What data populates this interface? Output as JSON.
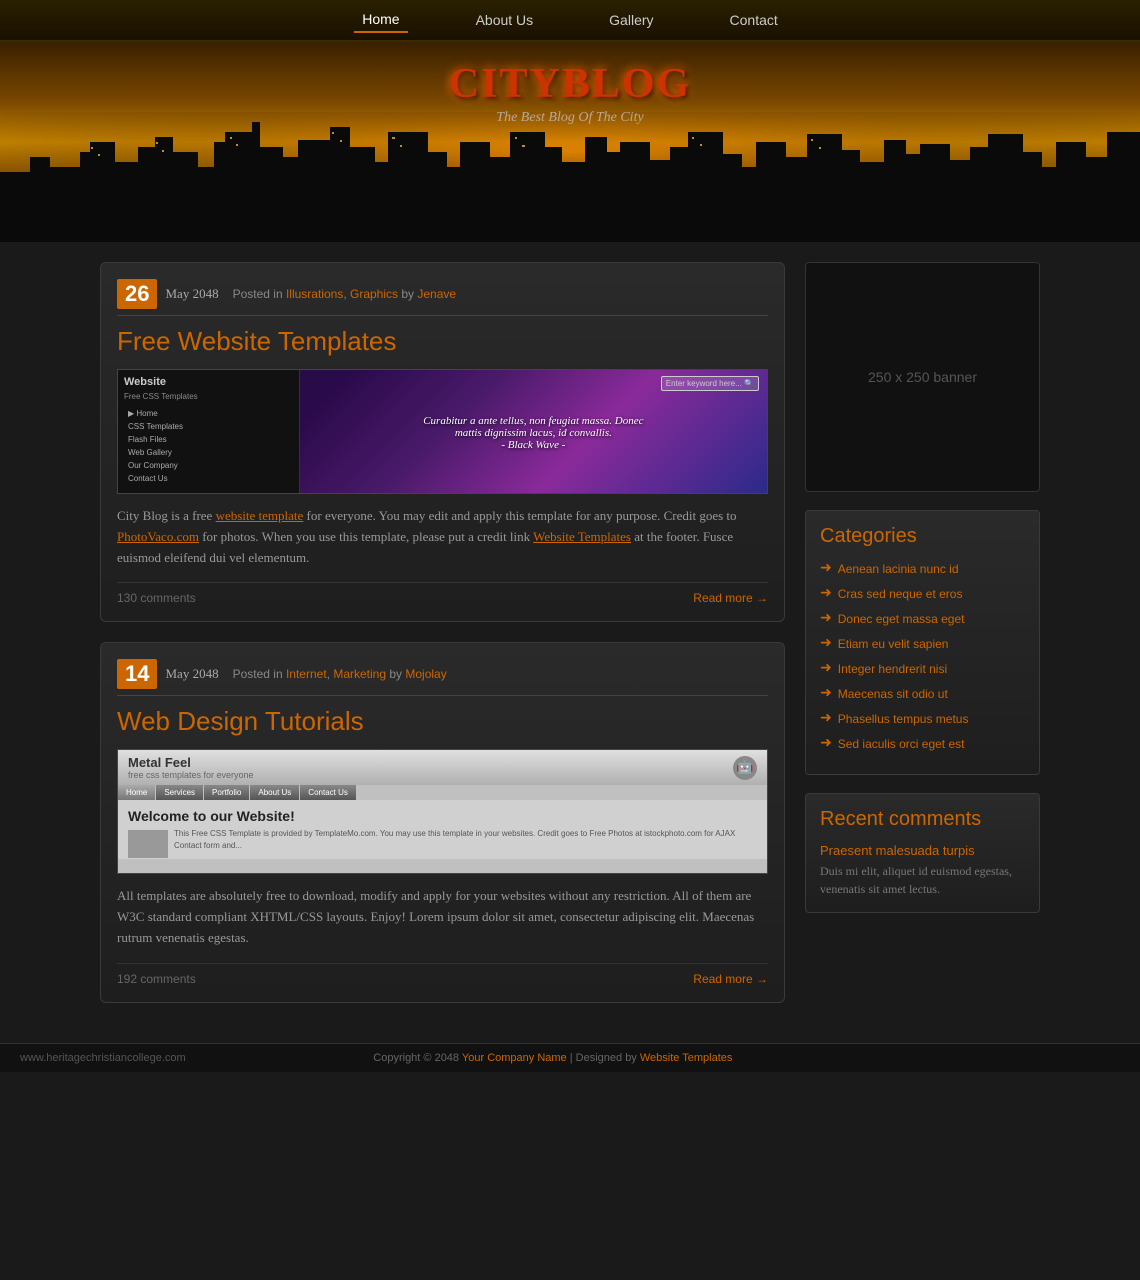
{
  "nav": {
    "items": [
      {
        "label": "Home",
        "active": true
      },
      {
        "label": "About Us",
        "active": false
      },
      {
        "label": "Gallery",
        "active": false
      },
      {
        "label": "Contact",
        "active": false
      }
    ]
  },
  "header": {
    "title": "CITYBLOG",
    "subtitle": "The Best Blog Of The City"
  },
  "posts": [
    {
      "date_num": "26",
      "date_month": "May 2048",
      "meta": "Posted in",
      "categories": [
        "Illusrations",
        "Graphics"
      ],
      "by": "by",
      "author": "Jenave",
      "title": "Free Website Templates",
      "body": "City Blog is a free website template for everyone. You may edit and apply this template for any purpose. Credit goes to PhotoVaco.com for photos. When you use this template, please put a credit link Website Templates at the footer. Fusce euismod eleifend dui vel elementum.",
      "comments": "130 comments",
      "read_more": "Read more"
    },
    {
      "date_num": "14",
      "date_month": "May 2048",
      "meta": "Posted in",
      "categories": [
        "Internet",
        "Marketing"
      ],
      "by": "by",
      "author": "Mojolay",
      "title": "Web Design Tutorials",
      "body": "All templates are absolutely free to download, modify and apply for your websites without any restriction. All of them are W3C standard compliant XHTML/CSS layouts. Enjoy! Lorem ipsum dolor sit amet, consectetur adipiscing elit. Maecenas rutrum venenatis egestas.",
      "comments": "192 comments",
      "read_more": "Read more"
    }
  ],
  "sidebar": {
    "banner": {
      "text": "250 x 250\nbanner"
    },
    "categories": {
      "title": "Categories",
      "items": [
        "Aenean lacinia nunc id",
        "Cras sed neque et eros",
        "Donec eget massa eget",
        "Etiam eu velit sapien",
        "Integer hendrerit nisi",
        "Maecenas sit odio ut",
        "Phasellus tempus metus",
        "Sed iaculis orci eget est"
      ]
    },
    "recent_comments": {
      "title": "Recent comments",
      "comment_title": "Praesent malesuada turpis",
      "comment_text": "Duis mi elit, aliquet id euismod egestas, venenatis sit amet lectus."
    }
  },
  "footer": {
    "url": "www.heritagechristiancollege.com",
    "copy": "Copyright © 2048",
    "company": "Your Company Name",
    "designed_by": "Designed by",
    "template_link": "Website Templates"
  },
  "post1_img": {
    "menu": [
      "Home",
      "CSS Templates",
      "Flash Files",
      "Web Gallery",
      "Our Company",
      "Contact Us"
    ],
    "title": "Website",
    "subtitle": "Free CSS Templates",
    "search_placeholder": "Enter keyword here...",
    "quote": "Curabitur a ante tellus, non feugiat massa. Donec\nmattis dignissim lacus, id convallis.\n- Black Wave -"
  },
  "post2_img": {
    "logo": "Metal Feel",
    "tagline": "free css templates for everyone",
    "nav": [
      "Home",
      "Services",
      "Portfolio",
      "About Us",
      "Contact Us"
    ],
    "welcome": "Welcome to our Website!",
    "text": "This Free CSS Template is provided by TemplateMo.com. You may use this template in your websites. Credit goes to Free Photos at istockphoto.com for AJAX Contact form and..."
  }
}
